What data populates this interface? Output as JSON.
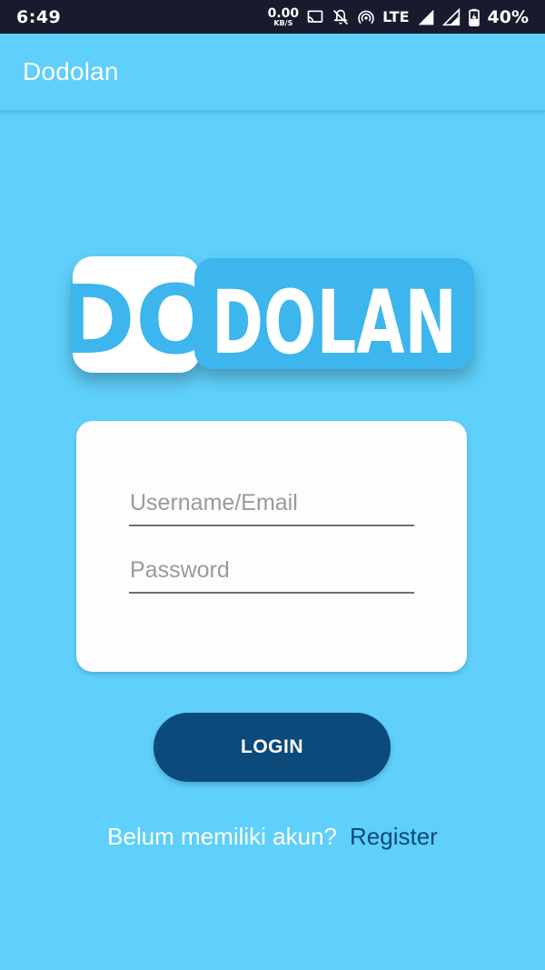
{
  "status_bar": {
    "time": "6:49",
    "net_speed_value": "0.00",
    "net_speed_unit": "KB/S",
    "network_type": "LTE",
    "battery": "40%",
    "icons": [
      "cast-icon",
      "notifications-off-icon",
      "hotspot-icon",
      "signal-icon",
      "signal-icon",
      "battery-charging-icon"
    ]
  },
  "app_bar": {
    "title": "Dodolan"
  },
  "logo": {
    "text_part1": "DO",
    "text_part2": "DOLAN",
    "colors": {
      "primary": "#3cb6ec",
      "white": "#ffffff"
    }
  },
  "form": {
    "username_placeholder": "Username/Email",
    "username_value": "",
    "password_placeholder": "Password",
    "password_value": ""
  },
  "login_button": {
    "label": "LOGIN"
  },
  "register": {
    "prompt": "Belum memiliki akun?",
    "link_label": "Register"
  },
  "colors": {
    "background": "#5fcffb",
    "button": "#0b4a7a",
    "card": "#fdfdfd",
    "status_bar": "#1a1a2e"
  }
}
